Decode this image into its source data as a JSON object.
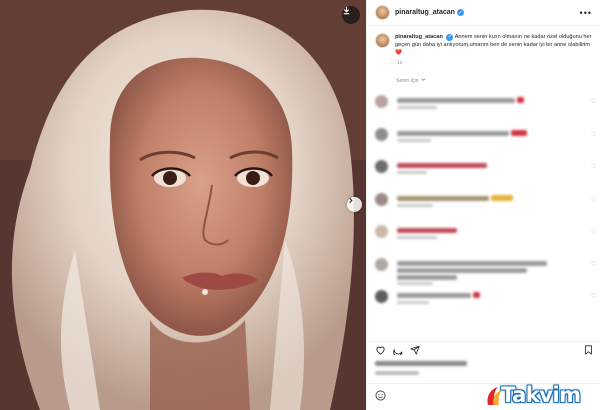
{
  "post": {
    "username": "pinaraltug_atacan",
    "caption_username": "pinaraltug_atacan",
    "caption": "Annem senin kızın olmanın ne kadar özel olduğunu her geçen gün daha iyi anlıyorum,umarım ben de senin kadar iyi bir anne olabilirim",
    "caption_emoji": "❤️",
    "time_ago": "1s",
    "for_you_label": "Senin için",
    "more_icon": "more-horizontal-icon",
    "verified_icon": "verified-badge-icon"
  },
  "comments": [
    {
      "avatar_color": "#b7a39c",
      "line_color": "#9b9b9b",
      "line_width": 118,
      "emoji": "red-heart",
      "two_lines": false,
      "meta_width": 40
    },
    {
      "avatar_color": "#8d8d8d",
      "line_color": "#9b9b9b",
      "line_width": 112,
      "emoji": "red-hearts",
      "two_lines": false,
      "meta_width": 34
    },
    {
      "avatar_color": "#6d6d6d",
      "line_color": "#c24a5a",
      "line_width": 90,
      "emoji": "hearts-row",
      "two_lines": false,
      "meta_width": 30
    },
    {
      "avatar_color": "#9a8a86",
      "line_color": "#a39370",
      "line_width": 92,
      "emoji": "face-emojis",
      "two_lines": false,
      "meta_width": 36
    },
    {
      "avatar_color": "#c9b8a8",
      "line_color": "#c24a5a",
      "line_width": 60,
      "emoji": "hearts-row",
      "two_lines": false,
      "meta_width": 40
    },
    {
      "avatar_color": "#b0a6a2",
      "line_color": "#9b9b9b",
      "line_width": 150,
      "emoji": "none",
      "two_lines": true,
      "meta_width": 36
    },
    {
      "avatar_color": "#5d5d5d",
      "line_color": "#9b9b9b",
      "line_width": 74,
      "emoji": "red-heart",
      "two_lines": false,
      "meta_width": 32
    }
  ],
  "actions": {
    "like_icon": "heart-icon",
    "comment_icon": "comment-icon",
    "share_icon": "share-icon",
    "save_icon": "bookmark-icon"
  },
  "add_comment": {
    "emoji_icon": "smiley-icon",
    "placeholder": ""
  },
  "photo": {
    "save_icon": "download-icon",
    "next_icon": "chevron-right-icon"
  },
  "watermark": {
    "text": "Takvim.com.tr",
    "visible_text": "Takvim"
  }
}
